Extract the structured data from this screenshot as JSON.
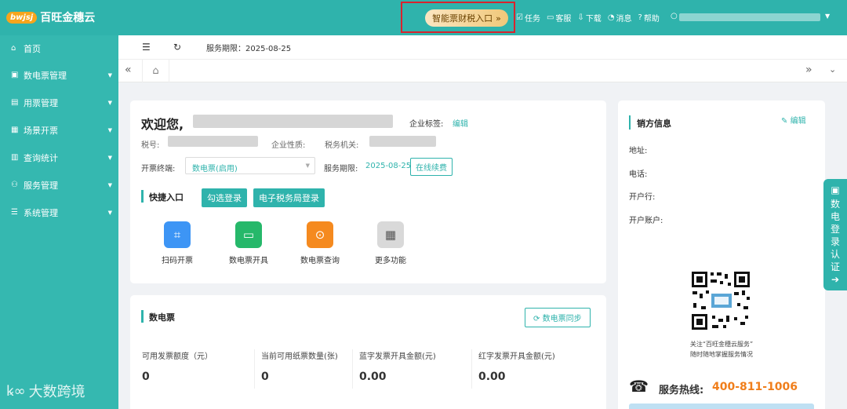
{
  "header": {
    "logo_badge": "bwjsj",
    "logo_text": "百旺金穗云",
    "smart_entry": "智能票财税入口",
    "links": [
      {
        "icon": "task-icon",
        "label": "任务"
      },
      {
        "icon": "service-icon",
        "label": "客服"
      },
      {
        "icon": "download-icon",
        "label": "下载"
      },
      {
        "icon": "bell-icon",
        "label": "消息"
      },
      {
        "icon": "help-icon",
        "label": "帮助"
      }
    ]
  },
  "sidebar": {
    "items": [
      {
        "label": "首页",
        "icon": "home-icon"
      },
      {
        "label": "数电票管理",
        "icon": "invoice-icon"
      },
      {
        "label": "用票管理",
        "icon": "ticket-icon"
      },
      {
        "label": "场景开票",
        "icon": "scene-icon"
      },
      {
        "label": "查询统计",
        "icon": "stats-icon"
      },
      {
        "label": "服务管理",
        "icon": "service-mgmt-icon"
      },
      {
        "label": "系统管理",
        "icon": "settings-icon"
      }
    ],
    "watermark": "大数跨境"
  },
  "toolbar": {
    "service_term": "服务期限：2025-08-25"
  },
  "welcome": {
    "greeting": "欢迎您,",
    "tag_label": "企业标签:",
    "edit": "编辑",
    "tax_no_label": "税号:",
    "nature_label": "企业性质:",
    "authority_label": "税务机关:",
    "terminal_label": "开票终端:",
    "terminal_value": "数电票(启用)",
    "term_label": "服务期限:",
    "term_value": "2025-08-25",
    "renew": "在线续费",
    "quick_title": "快捷入口",
    "btn_select_login": "勾选登录",
    "btn_etax_login": "电子税务局登录",
    "quick": [
      {
        "label": "扫码开票",
        "icon": "scan-icon",
        "color": "#3d95f5"
      },
      {
        "label": "数电票开具",
        "icon": "issue-icon",
        "color": "#26b86a"
      },
      {
        "label": "数电票查询",
        "icon": "query-icon",
        "color": "#f58a1f"
      },
      {
        "label": "更多功能",
        "icon": "more-icon",
        "color": "#d9d9d9"
      }
    ]
  },
  "einvoice": {
    "title": "数电票",
    "sync": "数电票同步",
    "stats": [
      {
        "label": "可用发票额度（元）",
        "value": "0"
      },
      {
        "label": "当前可用纸票数量(张)",
        "value": "0"
      },
      {
        "label": "蓝字发票开具金额(元)",
        "value": "0.00"
      },
      {
        "label": "红字发票开具金额(元)",
        "value": "0.00"
      }
    ]
  },
  "seller": {
    "title": "销方信息",
    "edit": "编辑",
    "address": "地址:",
    "phone": "电话:",
    "bank": "开户行:",
    "account": "开户账户:",
    "qr_caption_1": "关注“百旺金穗云服务”",
    "qr_caption_2": "随时随地掌握服务情况",
    "hotline_label": "服务热线:",
    "hotline": "400-811-1006"
  },
  "right_tab": {
    "text": "数电登录认证"
  }
}
